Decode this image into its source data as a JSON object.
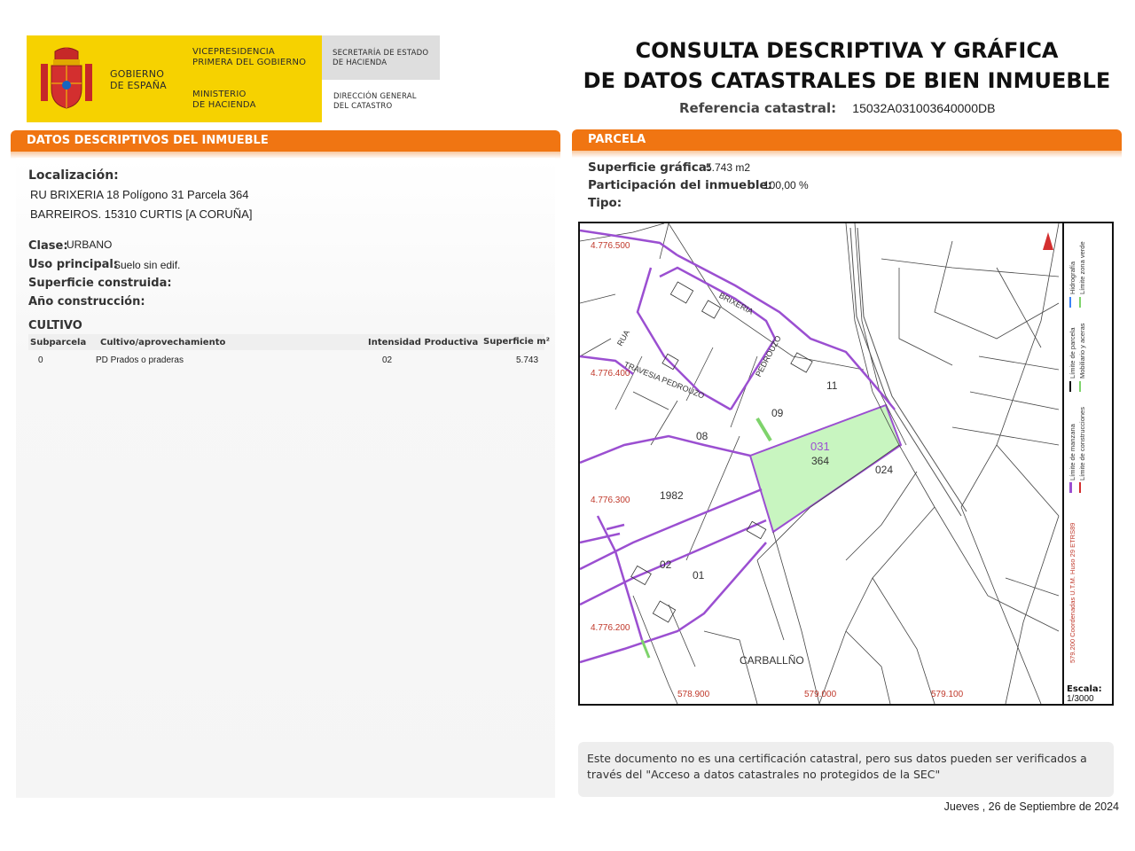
{
  "header": {
    "gov_name": [
      "GOBIERNO",
      "DE ESPAÑA"
    ],
    "vicepresidencia": [
      "VICEPRESIDENCIA",
      "PRIMERA DEL GOBIERNO"
    ],
    "ministerio": [
      "MINISTERIO",
      "DE HACIENDA"
    ],
    "secretaria": [
      "SECRETARÍA DE ESTADO",
      "DE HACIENDA"
    ],
    "direccion": [
      "DIRECCIÓN GENERAL",
      "DEL CATASTRO"
    ],
    "brand_colors": {
      "yellow": "#f6d200",
      "gray": "#dedede",
      "orange": "#f07512"
    }
  },
  "title": {
    "line1": "CONSULTA DESCRIPTIVA Y GRÁFICA",
    "line2": "DE DATOS CATASTRALES DE BIEN INMUEBLE",
    "ref_label": "Referencia catastral:",
    "ref_value": "15032A031003640000DB"
  },
  "descriptive": {
    "header": "DATOS DESCRIPTIVOS DEL INMUEBLE",
    "localizacion_label": "Localización:",
    "address_line1": "RU BRIXERIA 18 Polígono 31 Parcela 364",
    "address_line2": "BARREIROS. 15310 CURTIS [A CORUÑA]",
    "clase_label": "Clase:",
    "clase_value": "URBANO",
    "uso_label": "Uso principal:",
    "uso_value": "Suelo sin edif.",
    "superficie_label": "Superficie construida:",
    "anio_label": "Año construcción:",
    "cultivo_title": "CULTIVO",
    "cultivo_columns": [
      "Subparcela",
      "Cultivo/aprovechamiento",
      "Intensidad Productiva",
      "Superficie m²"
    ],
    "cultivo_rows": [
      {
        "subparcela": "0",
        "cultivo": "PD Prados o praderas",
        "intensidad": "02",
        "superficie": "5.743"
      }
    ]
  },
  "parcela": {
    "header": "PARCELA",
    "superficie_label": "Superficie gráfica:",
    "superficie_value": "5.743 m2",
    "participacion_label": "Participación del inmueble:",
    "participacion_value": "100,00 %",
    "tipo_label": "Tipo:"
  },
  "map": {
    "parcel_labels": [
      "031",
      "364",
      "024",
      "09",
      "08",
      "11",
      "1982",
      "02",
      "01",
      "CARBALLÑO"
    ],
    "parcel_labels_text": {
      "poly": "031",
      "parcel": "364",
      "p024": "024",
      "p09": "09",
      "p08": "08",
      "p11": "11",
      "p1982": "1982",
      "p02": "02",
      "p01": "01",
      "place": "CARBALLÑO"
    },
    "coord_labels": {
      "y1": "4.776.500",
      "y2": "4.776.400",
      "y3": "4.776.300",
      "y4": "4.776.200",
      "x1": "578.900",
      "x2": "579.000",
      "x3": "579.100"
    },
    "street_labels": {
      "s1": "RUA",
      "s2": "BRIXERIA",
      "s3": "TRAVESIA PEDROUZO",
      "s4": "PEDROUZO"
    },
    "legend": {
      "coords": "579.200 Coordenadas U.T.M. Huso 29 ETRS89",
      "col1a": "Límite de manzana",
      "col1b": "Límite de construcciones",
      "col2a": "Límite de parcela",
      "col2b": "Mobiliario y aceras",
      "col3a": "Hidrografía",
      "col3b": "Límite zona verde"
    },
    "scale_label": "Escala:",
    "scale_value": "1/3000",
    "colors": {
      "manzana": "#9b4fd1",
      "parcela_highlight": "#c8f5c0",
      "coords": "#c0392b"
    }
  },
  "footer": {
    "note": "Este documento no es una certificación catastral, pero sus datos pueden ser verificados a través del \"Acceso a datos catastrales no protegidos de la SEC\"",
    "date": "Jueves , 26 de Septiembre de 2024"
  }
}
